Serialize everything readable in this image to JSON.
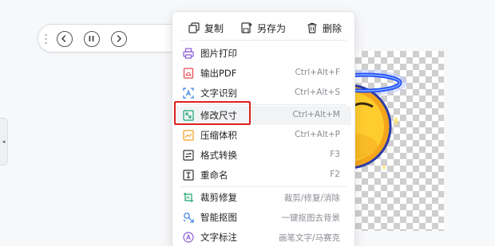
{
  "toolbar": {
    "prev_icon": "chevron-left-icon",
    "pause_icon": "pause-icon",
    "next_icon": "chevron-right-icon",
    "save_icon": "save-icon"
  },
  "context_menu": {
    "top_actions": [
      {
        "label": "复制",
        "icon": "copy-icon"
      },
      {
        "label": "另存为",
        "icon": "save-as-icon"
      },
      {
        "label": "删除",
        "icon": "trash-icon"
      }
    ],
    "items": [
      {
        "label": "图片打印",
        "shortcut": "",
        "icon": "printer-icon",
        "color": "#8a5cd6"
      },
      {
        "label": "输出PDF",
        "shortcut": "Ctrl+Alt+F",
        "icon": "pdf-icon",
        "color": "#e5484d"
      },
      {
        "label": "文字识别",
        "shortcut": "Ctrl+Alt+S",
        "icon": "ocr-icon",
        "color": "#2f7de1"
      },
      {
        "label": "修改尺寸",
        "shortcut": "Ctrl+Alt+M",
        "icon": "resize-icon",
        "color": "#1aa672"
      },
      {
        "label": "压缩体积",
        "shortcut": "Ctrl+Alt+P",
        "icon": "compress-icon",
        "color": "#f0a020"
      },
      {
        "label": "格式转换",
        "shortcut": "F3",
        "icon": "convert-icon",
        "color": "#333333"
      },
      {
        "label": "重命名",
        "shortcut": "F2",
        "icon": "rename-icon",
        "color": "#333333"
      },
      {
        "label": "裁剪修复",
        "shortcut": "裁剪/修复/消除",
        "icon": "crop-repair-icon",
        "color": "#1aa672"
      },
      {
        "label": "智能抠图",
        "shortcut": "一键抠图去背景",
        "icon": "cutout-icon",
        "color": "#2f7de1"
      },
      {
        "label": "文字标注",
        "shortcut": "画笔文字/马赛克",
        "icon": "annotate-icon",
        "color": "#8a5cd6"
      }
    ]
  },
  "colors": {
    "highlight": "#e02020",
    "hover": "#f2f3f5"
  }
}
